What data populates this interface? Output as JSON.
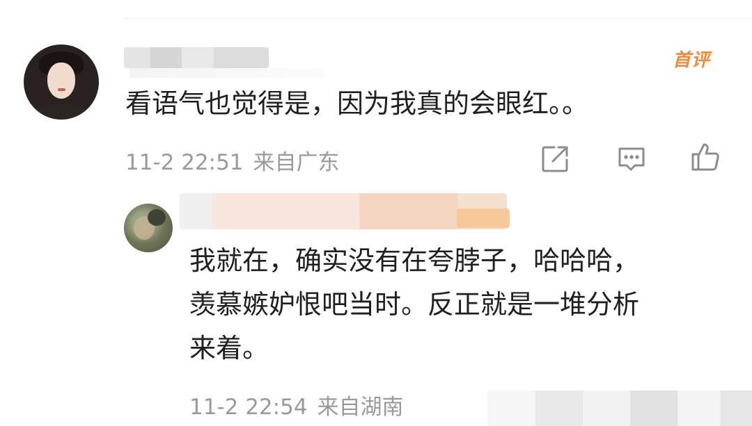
{
  "comment": {
    "badge": "首评",
    "text": "看语气也觉得是，因为我真的会眼红。。",
    "time": "11-2 22:51",
    "location": "来自广东"
  },
  "reply": {
    "lines": [
      "我就在，确实没有在夸脖子，哈哈哈，",
      "羡慕嫉妒恨吧当时。反正就是一堆分析",
      "来着。"
    ],
    "time": "11-2 22:54",
    "location": "来自湖南"
  },
  "icons": {
    "share": "share-icon",
    "reply": "comment-icon",
    "like": "thumbs-up-icon"
  },
  "colors": {
    "badge": "#f08a3a",
    "text": "#1f1f1f",
    "meta": "#9a9a9a",
    "icon": "#8c8c8c"
  }
}
